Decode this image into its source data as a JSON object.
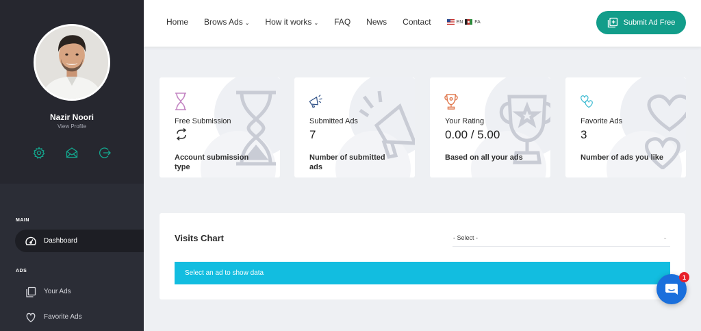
{
  "sidebar": {
    "profile": {
      "name": "Nazir Noori",
      "link": "View Profile",
      "icons": [
        "gear-icon",
        "envelope-icon",
        "logout-icon"
      ]
    },
    "sections": [
      {
        "label": "MAIN",
        "items": [
          {
            "label": "Dashboard",
            "icon": "dashboard-gauge-icon",
            "active": true
          }
        ]
      },
      {
        "label": "ADS",
        "items": [
          {
            "label": "Your Ads",
            "icon": "copy-icon"
          },
          {
            "label": "Favorite Ads",
            "icon": "heart-icon"
          }
        ]
      }
    ]
  },
  "header": {
    "menu": [
      {
        "label": "Home",
        "dropdown": false
      },
      {
        "label": "Brows Ads",
        "dropdown": true
      },
      {
        "label": "How it works",
        "dropdown": true
      },
      {
        "label": "FAQ",
        "dropdown": false
      },
      {
        "label": "News",
        "dropdown": false
      },
      {
        "label": "Contact",
        "dropdown": false
      }
    ],
    "languages": {
      "en": "EN",
      "fa": "FA"
    },
    "submit_label": "Submit Ad Free"
  },
  "cards": [
    {
      "title": "Free Submission",
      "value": "",
      "value_icon": "repeat-icon",
      "desc": "Account submission type",
      "icon": "hourglass-icon"
    },
    {
      "title": "Submitted Ads",
      "value": "7",
      "desc": "Number of submitted ads",
      "icon": "megaphone-icon"
    },
    {
      "title": "Your Rating",
      "value": "0.00 / 5.00",
      "desc": "Based on all your ads",
      "icon": "trophy-icon"
    },
    {
      "title": "Favorite Ads",
      "value": "3",
      "desc": "Number of ads you like",
      "icon": "hearts-icon"
    }
  ],
  "visits": {
    "title": "Visits Chart",
    "select_value": "- Select -",
    "message": "Select an ad to show data"
  },
  "chat": {
    "badge": "1"
  },
  "colors": {
    "accent": "#129d8a",
    "sidebar": "#2b2d36",
    "info": "#12bde0",
    "chat": "#1a6fdc",
    "badge": "#e8202a"
  }
}
